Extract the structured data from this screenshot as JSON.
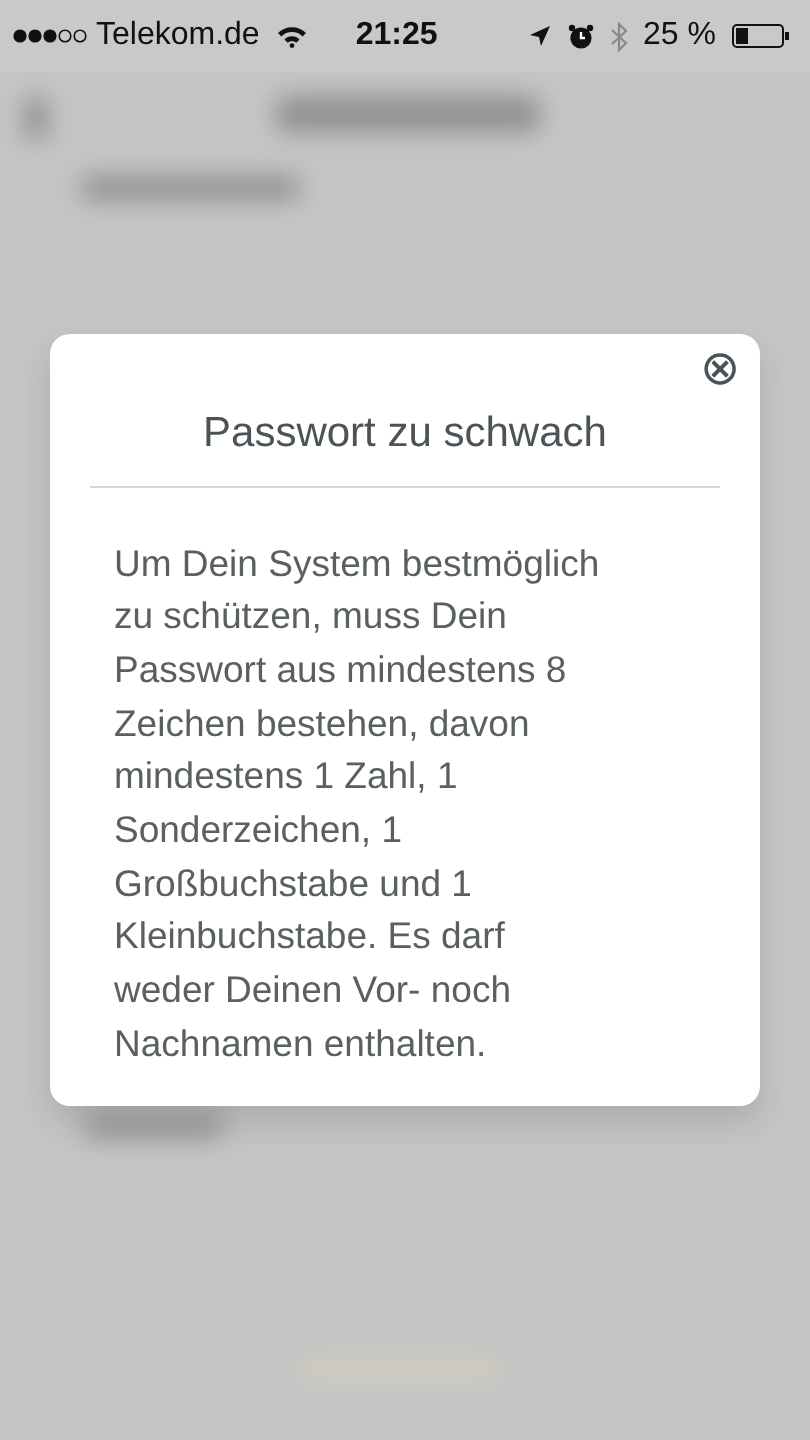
{
  "status_bar": {
    "carrier": "Telekom.de",
    "time": "21:25",
    "battery": "25 %"
  },
  "dialog": {
    "close": "⊗",
    "title": "Passwort zu schwach",
    "message": "Um Dein System bestmöglich\nzu schützen, muss Dein\nPasswort aus mindestens 8\nZeichen bestehen, davon\nmindestens 1 Zahl, 1\nSonderzeichen, 1\nGroßbuchstabe und 1\nKleinbuchstabe. Es darf\nweder Deinen Vor- noch\nNachnamen enthalten."
  }
}
